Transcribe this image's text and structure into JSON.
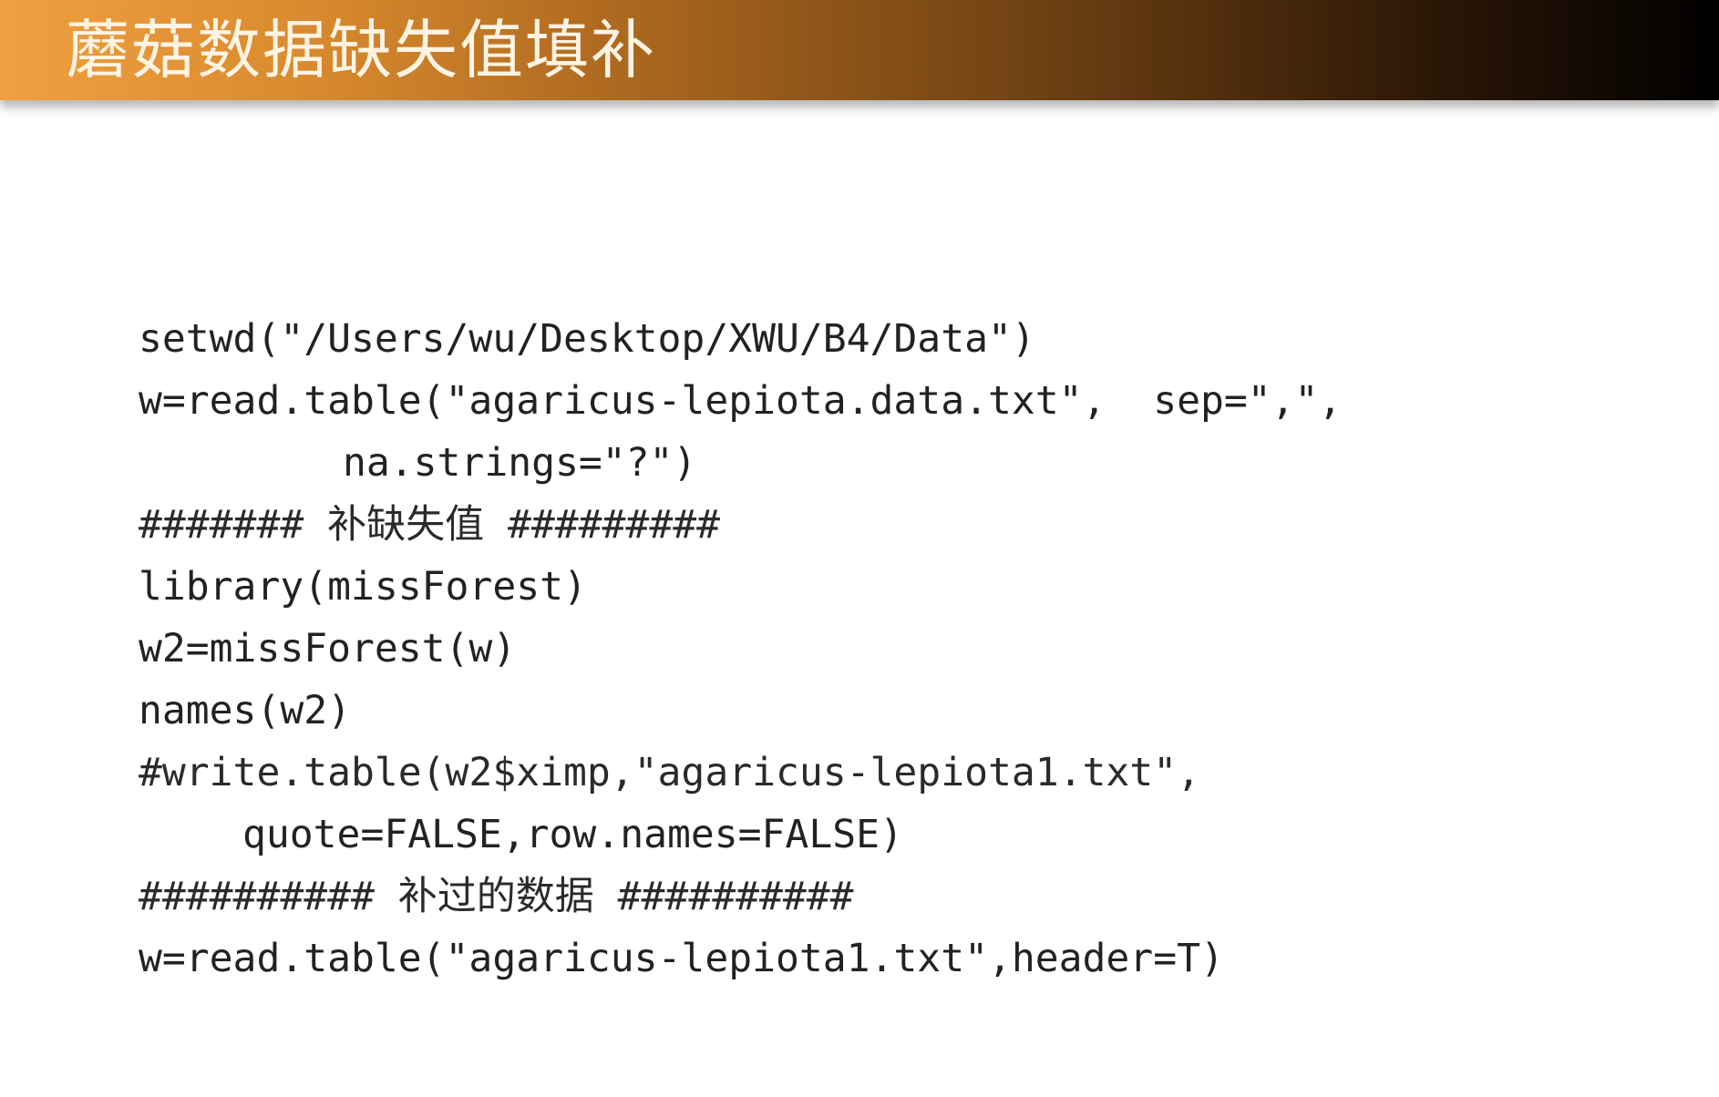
{
  "slide": {
    "title": "蘑菇数据缺失值填补"
  },
  "code": {
    "lines": [
      "setwd(\"/Users/wu/Desktop/XWU/B4/Data\")",
      "w=read.table(\"agaricus-lepiota.data.txt\",  sep=\",\",",
      "na.strings=\"?\")",
      "####### 补缺失值 #########",
      "library(missForest)",
      "w2=missForest(w)",
      "names(w2)",
      "#write.table(w2$ximp,\"agaricus-lepiota1.txt\",",
      "quote=FALSE,row.names=FALSE)",
      "########## 补过的数据 ##########",
      "w=read.table(\"agaricus-lepiota1.txt\",header=T)"
    ]
  },
  "colors": {
    "title_gradient_start": "#f0a040",
    "title_gradient_end": "#000000",
    "title_text": "#fff4e4",
    "code_text": "#222222",
    "background": "#ffffff"
  }
}
